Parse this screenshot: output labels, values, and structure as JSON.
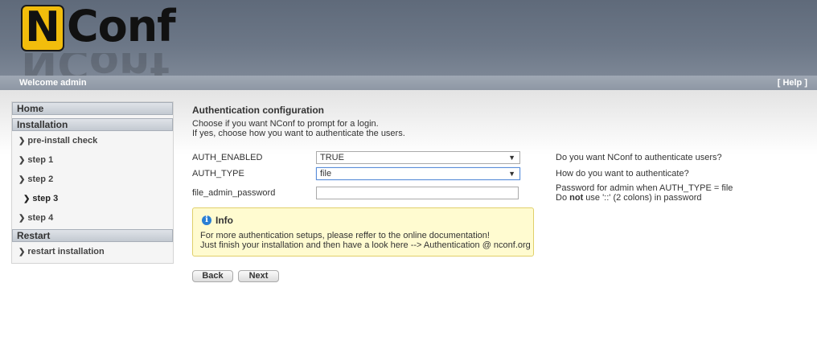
{
  "header": {
    "logo_n": "N",
    "logo_rest": "Conf"
  },
  "topbar": {
    "welcome": "Welcome admin",
    "help": "[ Help ]"
  },
  "sidebar": {
    "home": "Home",
    "installation": "Installation",
    "steps": [
      {
        "label": "pre-install check",
        "active": false
      },
      {
        "label": "step 1",
        "active": false
      },
      {
        "label": "step 2",
        "active": false
      },
      {
        "label": "step 3",
        "active": true
      },
      {
        "label": "step 4",
        "active": false
      }
    ],
    "restart": "Restart",
    "restart_item": "restart installation"
  },
  "main": {
    "title": "Authentication configuration",
    "desc_line1": "Choose if you want NConf to prompt for a login.",
    "desc_line2": "If yes, choose how you want to authenticate the users.",
    "fields": {
      "auth_enabled": {
        "label": "AUTH_ENABLED",
        "value": "TRUE",
        "help": "Do you want NConf to authenticate users?"
      },
      "auth_type": {
        "label": "AUTH_TYPE",
        "value": "file",
        "help": "How do you want to authenticate?"
      },
      "file_admin_password": {
        "label": "file_admin_password",
        "value": "",
        "help_line1": "Password for admin when AUTH_TYPE = file",
        "help_line2_pre": "Do ",
        "help_line2_bold": "not",
        "help_line2_post": " use '::' (2 colons) in password"
      }
    },
    "info": {
      "title": "Info",
      "line1": "For more authentication setups, please reffer to the online documentation!",
      "line2": "Just finish your installation and then have a look here --> Authentication @ nconf.org"
    },
    "buttons": {
      "back": "Back",
      "next": "Next"
    }
  },
  "colors": {
    "header_bg": "#6c7787",
    "logo_yellow": "#f2bd0c",
    "info_bg": "#fffbd0",
    "info_icon": "#2a7fd4"
  }
}
